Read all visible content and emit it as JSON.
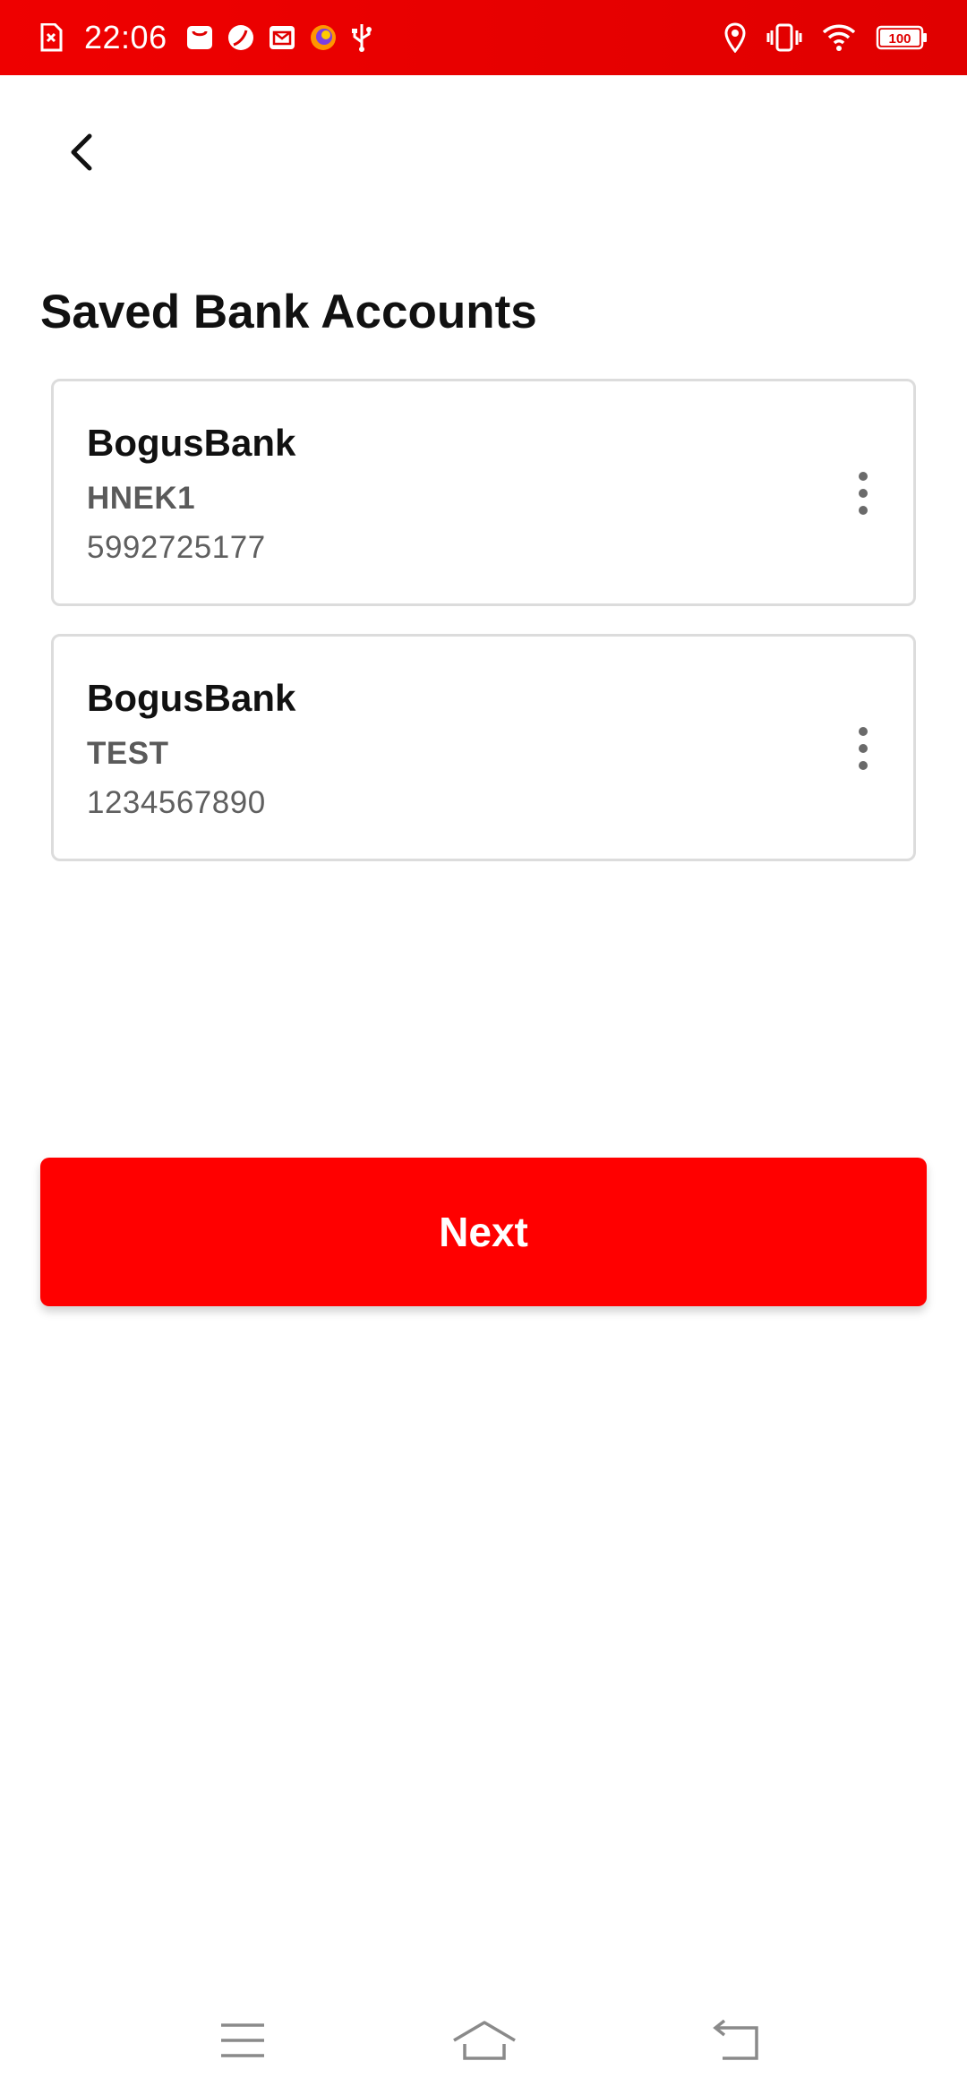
{
  "status_bar": {
    "time": "22:06",
    "battery": "100",
    "icons_left": [
      "sim-error-icon",
      "mail-bag-icon",
      "leaf-icon",
      "calendar-mail-icon",
      "firefox-icon",
      "usb-icon"
    ],
    "icons_right": [
      "location-icon",
      "vibrate-icon",
      "wifi-icon",
      "battery-icon"
    ],
    "background_color": "#e60000"
  },
  "header": {
    "back_icon": "chevron-left-icon"
  },
  "page": {
    "title": "Saved Bank Accounts"
  },
  "accounts": [
    {
      "bank": "BogusBank",
      "name": "HNEK1",
      "number": "5992725177",
      "menu_icon": "more-vertical-icon"
    },
    {
      "bank": "BogusBank",
      "name": "TEST",
      "number": "1234567890",
      "menu_icon": "more-vertical-icon"
    }
  ],
  "actions": {
    "next_label": "Next",
    "accent_color": "#ff0000"
  },
  "nav_bar": {
    "items": [
      "menu-icon",
      "home-icon",
      "back-icon"
    ]
  }
}
